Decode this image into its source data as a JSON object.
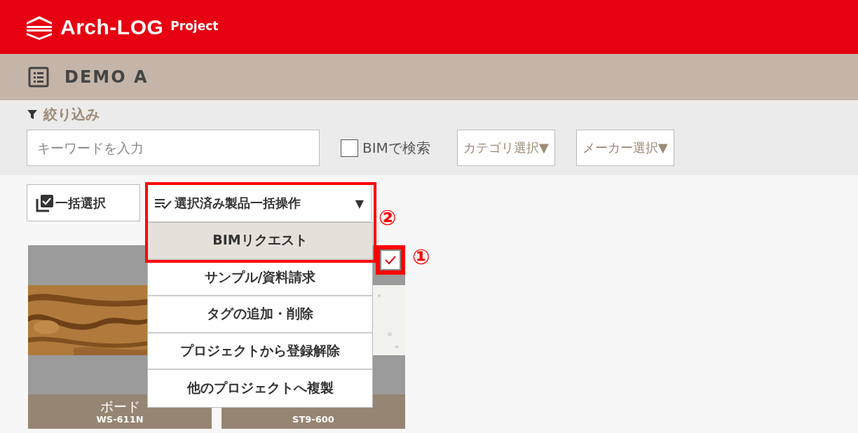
{
  "header": {
    "logo": "Arch-LOG",
    "product": "Project"
  },
  "project": {
    "title": "DEMO A"
  },
  "filter": {
    "heading": "絞り込み",
    "keyword": {
      "placeholder": "キーワードを入力"
    },
    "bim_search": {
      "label": "BIMで検索",
      "checked": false
    },
    "selects": [
      "カテゴリ選択▼",
      "メーカー選択▼"
    ]
  },
  "toolbar": {
    "select_all": "一括選択",
    "bulk_menu": {
      "label": "選択済み製品一括操作",
      "caret": "▼",
      "expanded": true,
      "items": [
        {
          "label": "BIMリクエスト",
          "selected": true
        },
        {
          "label": "サンプル/資料請求",
          "selected": false
        },
        {
          "label": "タグの追加・削除",
          "selected": false
        },
        {
          "label": "プロジェクトから登録解除",
          "selected": false
        },
        {
          "label": "他のプロジェクトへ複製",
          "selected": false
        }
      ]
    }
  },
  "products": [
    {
      "kind": "wood",
      "name": "ボード",
      "code": "WS-611N"
    },
    {
      "kind": "stone",
      "code": "ST9-600",
      "checked": true
    }
  ],
  "annotations": [
    {
      "label": "①"
    },
    {
      "label": "②"
    }
  ]
}
